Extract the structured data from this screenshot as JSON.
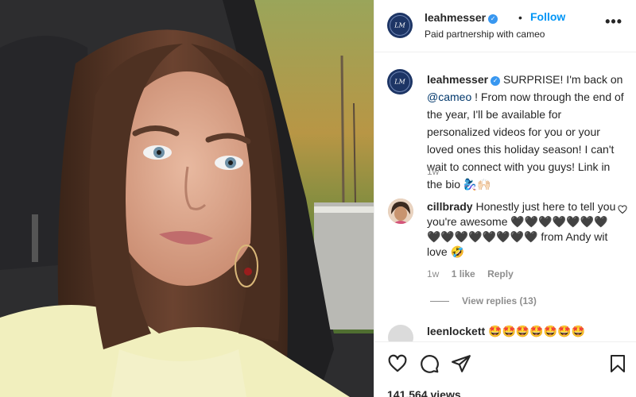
{
  "post": {
    "author": "leahmesser",
    "follow_label": "Follow",
    "separator": "•",
    "subtitle": "Paid partnership with cameo",
    "more_label": "•••",
    "avatar_monogram": "LM",
    "verified_glyph": "✓"
  },
  "caption": {
    "username": "leahmesser",
    "text_before_mention": " SURPRISE! I'm back on ",
    "mention": "@cameo",
    "text_after_mention": " ! From now through the end of the year, I'll be available for personalized videos for you or your loved ones this holiday season! I can't wait to connect with you guys! Link in the bio 🧞‍♀️🙌🏻",
    "time": "1w"
  },
  "comments": [
    {
      "username": "cillbrady",
      "text": " Honestly just here to tell you you're awesome 🖤🖤🖤🖤🖤🖤🖤🖤🖤🖤🖤🖤🖤🖤🖤 from Andy wit love 🤣",
      "time": "1w",
      "likes": "1 like",
      "reply_label": "Reply",
      "view_replies": "View replies (13)"
    },
    {
      "username": "leenlockett",
      "text": " 🤩🤩🤩🤩🤩🤩🤩"
    }
  ],
  "footer": {
    "views": "141,564 views"
  },
  "icons": {
    "header_avatar": "cameo-logo-icon",
    "verified": "verified-badge-icon",
    "heart": "heart-icon",
    "comment": "comment-icon",
    "share": "paper-plane-icon",
    "save": "bookmark-icon",
    "more": "more-options-icon"
  },
  "colors": {
    "follow": "#0095f6",
    "verified": "#3897f0",
    "mention": "#00376b",
    "secondary_text": "#8e8e8e",
    "cameo_brand": "#1d3565"
  }
}
